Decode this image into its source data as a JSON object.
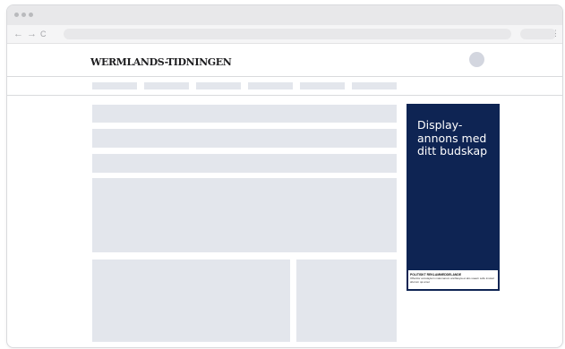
{
  "browser": {
    "nav_back": "←",
    "nav_forward": "→",
    "nav_reload": "C",
    "menu": "⋮"
  },
  "site": {
    "logo": "WERMLANDS-TIDNINGEN"
  },
  "ad": {
    "text": "Display-annons med ditt budskap",
    "footer_title": "POLITISKT REKLAMMEDDELANDE",
    "footer_body": "Offentlor annslaylern malomarum annflasyia et alio voawn sollu imolad aborum qa amet"
  }
}
